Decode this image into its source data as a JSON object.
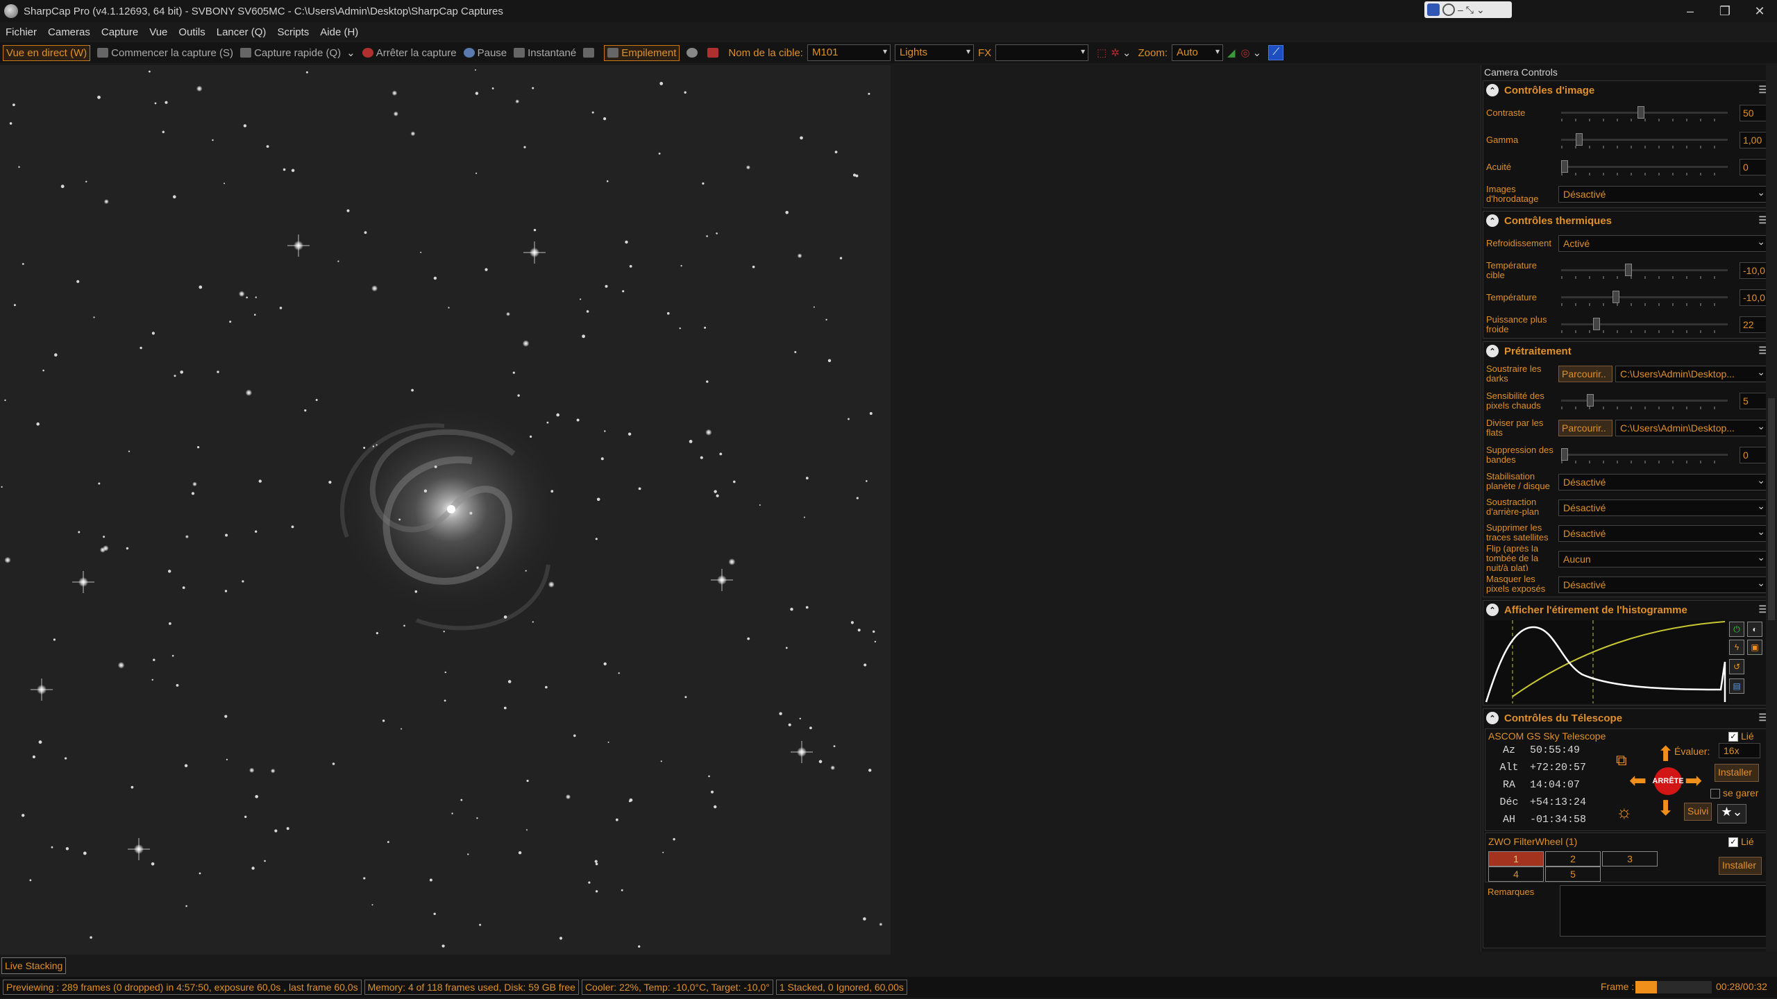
{
  "window": {
    "title": "SharpCap Pro (v4.1.12693, 64 bit) - SVBONY SV605MC - C:\\Users\\Admin\\Desktop\\SharpCap Captures",
    "minimize": "–",
    "maximize": "❐",
    "close": "✕"
  },
  "menu": [
    "Fichier",
    "Cameras",
    "Capture",
    "Vue",
    "Outils",
    "Lancer (Q)",
    "Scripts",
    "Aide (H)"
  ],
  "toolbar": {
    "live_view": "Vue en direct (W)",
    "start_capture": "Commencer la capture (S)",
    "quick_capture": "Capture rapide (Q)",
    "stop_capture": "Arrêter la capture",
    "pause": "Pause",
    "snapshot": "Instantané",
    "stacking": "Empilement",
    "target_label": "Nom de la cible:",
    "target_value": "M101",
    "frame_type": "Lights",
    "fx_label": "FX",
    "zoom_label": "Zoom:",
    "zoom_value": "Auto"
  },
  "panel": {
    "title": "Camera Controls",
    "image": {
      "header": "Contrôles d'image",
      "contrast_label": "Contraste",
      "contrast_value": "50",
      "contrast_pos": 0.48,
      "gamma_label": "Gamma",
      "gamma_value": "1,00",
      "gamma_pos": 0.09,
      "sharp_label": "Acuité",
      "sharp_value": "0",
      "sharp_pos": 0.0,
      "timestamp_label": "Images d'horodatage",
      "timestamp_value": "Désactivé"
    },
    "thermal": {
      "header": "Contrôles thermiques",
      "cooling_label": "Refroidissement",
      "cooling_value": "Activé",
      "target_label": "Température cible",
      "target_value": "-10,0",
      "target_pos": 0.4,
      "temp_label": "Température",
      "temp_value": "-10,0",
      "temp_pos": 0.32,
      "power_label": "Puissance plus froide",
      "power_value": "22",
      "power_pos": 0.2
    },
    "pre": {
      "header": "Prétraitement",
      "darks_label": "Soustraire les darks",
      "darks_btn": "Parcourir..",
      "darks_path": "C:\\Users\\Admin\\Desktop...",
      "hot_label": "Sensibilité des pixels chauds",
      "hot_value": "5",
      "hot_pos": 0.16,
      "flats_label": "Diviser par les flats",
      "flats_btn": "Parcourir..",
      "flats_path": "C:\\Users\\Admin\\Desktop...",
      "banding_label": "Suppression des bandes",
      "banding_value": "0",
      "banding_pos": 0.0,
      "stab_label": "Stabilisation planète / disque",
      "stab_value": "Désactivé",
      "bg_label": "Soustraction d'arrière-plan",
      "bg_value": "Désactivé",
      "sat_label": "Supprimer les traces satellites",
      "sat_value": "Désactivé",
      "flip_label": "Flip (après la tombée de la nuit/à plat)",
      "flip_value": "Aucun",
      "mask_label": "Masquer les pixels exposés",
      "mask_value": "Désactivé"
    },
    "histo": {
      "header": "Afficher l'étirement de l'histogramme"
    },
    "telescope": {
      "header": "Contrôles du Télescope",
      "name": "ASCOM GS Sky Telescope",
      "linked": "Lié",
      "az_k": "Az",
      "az_v": "50:55:49",
      "alt_k": "Alt",
      "alt_v": "+72:20:57",
      "ra_k": "RA",
      "ra_v": "14:04:07",
      "dec_k": "Déc",
      "dec_v": "+54:13:24",
      "ah_k": "AH",
      "ah_v": "-01:34:58",
      "rate_label": "Évaluer:",
      "rate_value": "16x",
      "setup": "Installer",
      "park": "se garer",
      "stop": "ARRÊTE",
      "track": "Suivi"
    },
    "filterwheel": {
      "name": "ZWO FilterWheel (1)",
      "linked": "Lié",
      "setup": "Installer",
      "slots": [
        "1",
        "2",
        "3",
        "4",
        "5"
      ]
    },
    "notes_label": "Remarques"
  },
  "live_stacking": "Live Stacking",
  "status": {
    "preview": "Previewing : 289 frames (0 dropped) in 4:57:50, exposure 60,0s , last frame 60,0s",
    "memory": "Memory: 4 of 118 frames used, Disk: 59 GB free",
    "cooler": "Cooler: 22%, Temp: -10,0°C, Target: -10,0°",
    "stack": "1 Stacked, 0 Ignored, 60,00s",
    "frame_label": "Frame :",
    "frame_progress": 0.28,
    "timer": "00:28/00:32"
  },
  "colors": {
    "accent": "#e0902a",
    "stop": "#d21515"
  }
}
